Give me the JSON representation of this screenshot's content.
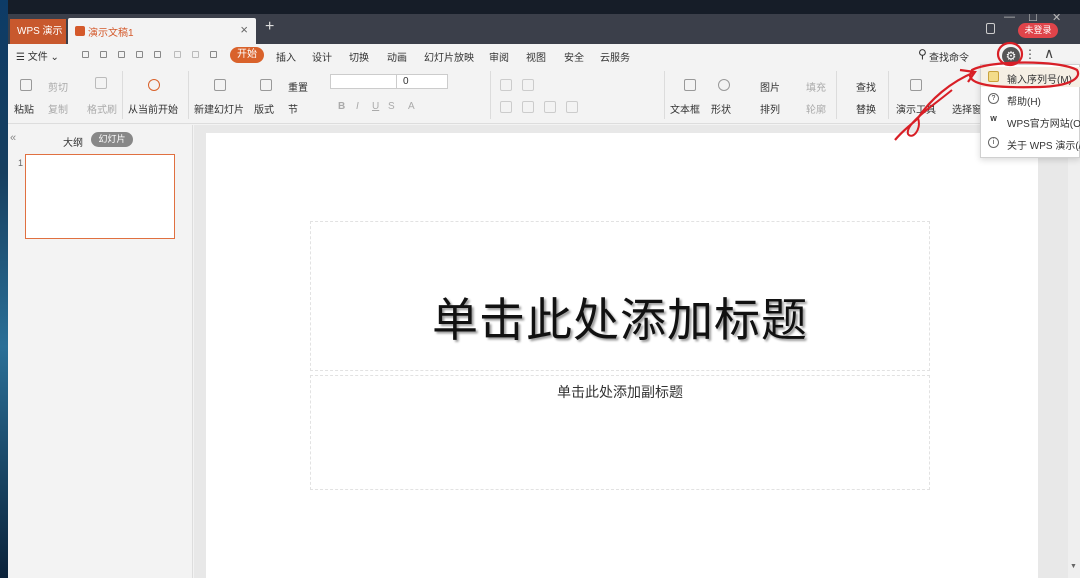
{
  "titlebar": {
    "app_tab": "WPS 演示",
    "doc_tab": "演示文稿1",
    "close_tab": "×",
    "new_tab": "+",
    "login_button": "未登录",
    "win_min": "—",
    "win_max": "☐",
    "win_close": "✕"
  },
  "menu": {
    "file": "☰ 文件 ⌄",
    "tabs": [
      "开始",
      "插入",
      "设计",
      "切换",
      "动画",
      "幻灯片放映",
      "审阅",
      "视图",
      "安全",
      "云服务"
    ],
    "search_command": "查找命令",
    "search_icon": "⚲",
    "gear": "⚙",
    "more": "⋮",
    "collapse": "∧"
  },
  "ribbon": {
    "paste": "粘贴",
    "cut": "剪切",
    "copy": "复制",
    "format_painter": "格式刷",
    "from_current": "从当前开始",
    "new_slide": "新建幻灯片",
    "layout": "版式",
    "reset": "重置",
    "section": "节",
    "font_size": "0",
    "textbox": "文本框",
    "shape": "形状",
    "picture": "图片",
    "arrange": "排列",
    "fill": "填充",
    "outline": "轮廓",
    "find": "查找",
    "replace": "替换",
    "presentation_tools": "演示工具",
    "select_pane": "选择窗"
  },
  "pane": {
    "chevron": "«",
    "outline_tab": "大纲",
    "slides_tab": "幻灯片",
    "slide_number": "1"
  },
  "slide": {
    "title_placeholder": "单击此处添加标题",
    "subtitle_placeholder": "单击此处添加副标题"
  },
  "dropdown": {
    "items": [
      {
        "icon": "key-icon",
        "label": "输入序列号(M)"
      },
      {
        "icon": "help-icon",
        "label": "帮助(H)"
      },
      {
        "icon": "wps-icon",
        "label": "WPS官方网站(O"
      },
      {
        "icon": "info-icon",
        "label": "关于 WPS 演示(/"
      }
    ]
  },
  "colors": {
    "accent": "#d9622b",
    "login": "#e0444a",
    "annotation": "#d81f26"
  }
}
